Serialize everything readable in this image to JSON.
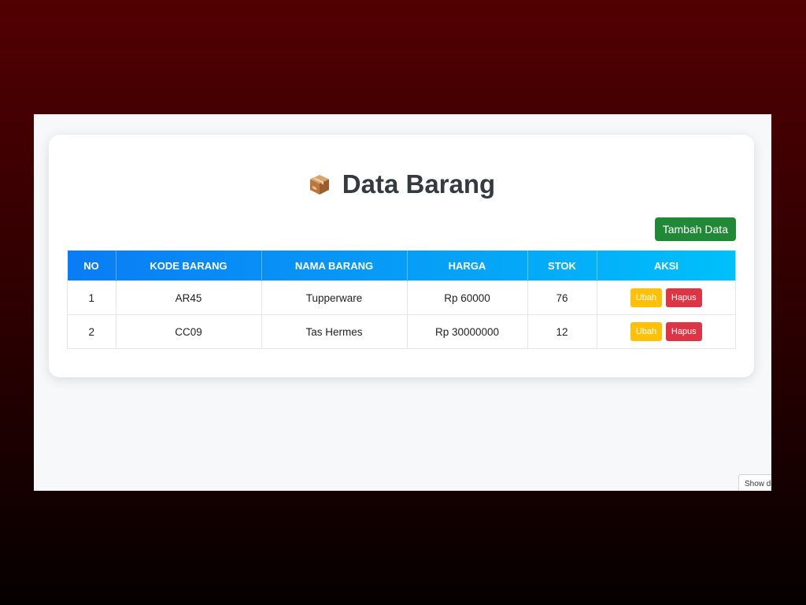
{
  "page": {
    "title": "Data Barang",
    "title_icon": "package-box-icon"
  },
  "toolbar": {
    "add_label": "Tambah Data"
  },
  "table": {
    "headers": [
      "NO",
      "KODE BARANG",
      "NAMA BARANG",
      "HARGA",
      "STOK",
      "AKSI"
    ],
    "rows": [
      {
        "no": "1",
        "kode": "AR45",
        "nama": "Tupperware",
        "harga": "Rp 60000",
        "stok": "76"
      },
      {
        "no": "2",
        "kode": "CC09",
        "nama": "Tas Hermes",
        "harga": "Rp 30000000",
        "stok": "12"
      }
    ],
    "edit_label": "Ubah",
    "delete_label": "Hapus"
  },
  "overlay": {
    "show_label": "Show de"
  },
  "colors": {
    "add_button": "#218838",
    "edit_button": "#ffc107",
    "delete_button": "#dc3545",
    "header_gradient_start": "#0a7cf5",
    "header_gradient_end": "#00c0fb",
    "title_text": "#343a40"
  }
}
